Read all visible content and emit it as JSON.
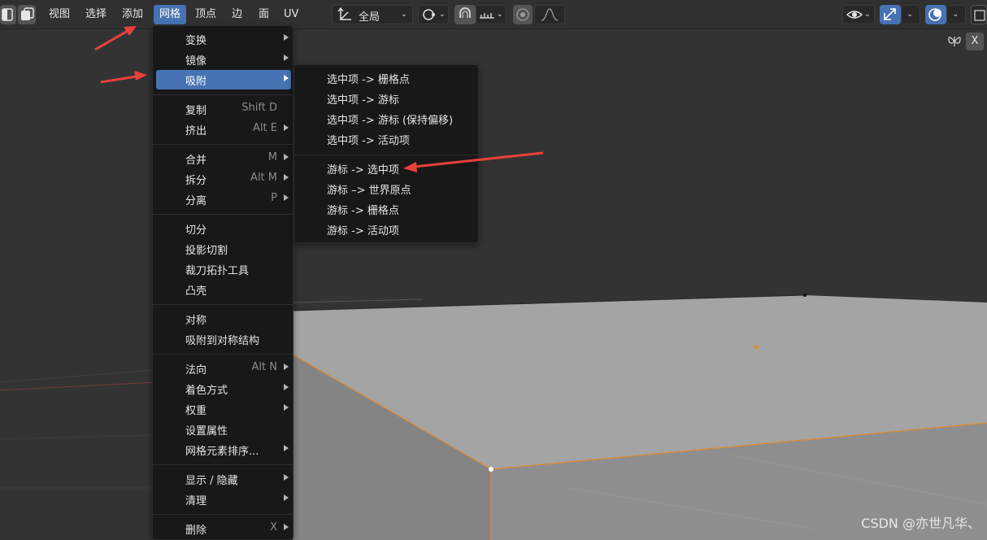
{
  "header": {
    "menus": [
      {
        "label": "视图",
        "active": false
      },
      {
        "label": "选择",
        "active": false
      },
      {
        "label": "添加",
        "active": false
      },
      {
        "label": "网格",
        "active": true
      },
      {
        "label": "顶点",
        "active": false
      },
      {
        "label": "边",
        "active": false
      },
      {
        "label": "面",
        "active": false
      },
      {
        "label": "UV",
        "active": false
      }
    ],
    "pivot_dropdown": {
      "value": "全局",
      "icon": "transform-orientation-icon"
    },
    "close_label": "X"
  },
  "mesh_menu": {
    "groups": [
      [
        {
          "label": "变换",
          "shortcut": "",
          "submenu": true,
          "highlight": false
        },
        {
          "label": "镜像",
          "shortcut": "",
          "submenu": true,
          "highlight": false
        },
        {
          "label": "吸附",
          "shortcut": "",
          "submenu": true,
          "highlight": true
        }
      ],
      [
        {
          "label": "复制",
          "shortcut": "Shift D",
          "submenu": false,
          "highlight": false
        },
        {
          "label": "挤出",
          "shortcut": "Alt E",
          "submenu": true,
          "highlight": false
        }
      ],
      [
        {
          "label": "合并",
          "shortcut": "M",
          "submenu": true,
          "highlight": false
        },
        {
          "label": "拆分",
          "shortcut": "Alt M",
          "submenu": true,
          "highlight": false
        },
        {
          "label": "分离",
          "shortcut": "P",
          "submenu": true,
          "highlight": false
        }
      ],
      [
        {
          "label": "切分",
          "shortcut": "",
          "submenu": false,
          "highlight": false
        },
        {
          "label": "投影切割",
          "shortcut": "",
          "submenu": false,
          "highlight": false
        },
        {
          "label": "裁刀拓扑工具",
          "shortcut": "",
          "submenu": false,
          "highlight": false
        },
        {
          "label": "凸壳",
          "shortcut": "",
          "submenu": false,
          "highlight": false
        }
      ],
      [
        {
          "label": "对称",
          "shortcut": "",
          "submenu": false,
          "highlight": false
        },
        {
          "label": "吸附到对称结构",
          "shortcut": "",
          "submenu": false,
          "highlight": false
        }
      ],
      [
        {
          "label": "法向",
          "shortcut": "Alt N",
          "submenu": true,
          "highlight": false
        },
        {
          "label": "着色方式",
          "shortcut": "",
          "submenu": true,
          "highlight": false
        },
        {
          "label": "权重",
          "shortcut": "",
          "submenu": true,
          "highlight": false
        },
        {
          "label": "设置属性",
          "shortcut": "",
          "submenu": false,
          "highlight": false
        },
        {
          "label": "网格元素排序...",
          "shortcut": "",
          "submenu": true,
          "highlight": false
        }
      ],
      [
        {
          "label": "显示 / 隐藏",
          "shortcut": "",
          "submenu": true,
          "highlight": false
        },
        {
          "label": "清理",
          "shortcut": "",
          "submenu": true,
          "highlight": false
        }
      ],
      [
        {
          "label": "删除",
          "shortcut": "X",
          "submenu": true,
          "highlight": false
        }
      ]
    ]
  },
  "snap_submenu": {
    "groups": [
      [
        {
          "label": "选中项 -> 栅格点"
        },
        {
          "label": "选中项 -> 游标"
        },
        {
          "label": "选中项 -> 游标 (保持偏移)"
        },
        {
          "label": "选中项 -> 活动项"
        }
      ],
      [
        {
          "label": "游标 -> 选中项"
        },
        {
          "label": "游标 –> 世界原点"
        },
        {
          "label": "游标 -> 栅格点"
        },
        {
          "label": "游标 -> 活动项"
        }
      ]
    ]
  },
  "watermark": "CSDN @亦世凡华、",
  "colors": {
    "accent": "#4772b3",
    "menu_bg": "#181818",
    "annotation_arrow": "#e8413a",
    "mesh_edge": "#e08a2c"
  }
}
